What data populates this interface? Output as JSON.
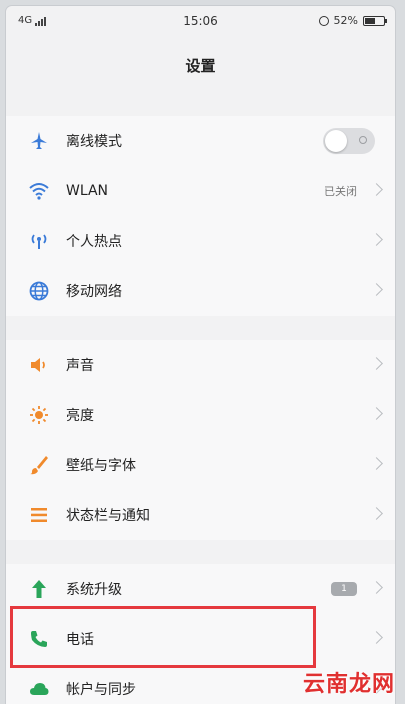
{
  "status_bar": {
    "network": "4G",
    "time": "15:06",
    "battery": "52%"
  },
  "title": "设置",
  "groups": [
    {
      "items": [
        {
          "name": "airplane",
          "label": "离线模式",
          "icon": "airplane-icon",
          "color": "#3b7bd8",
          "toggle": true,
          "toggle_on": false
        },
        {
          "name": "wlan",
          "label": "WLAN",
          "icon": "wifi-icon",
          "color": "#3b7bd8",
          "value": "已关闭"
        },
        {
          "name": "hotspot",
          "label": "个人热点",
          "icon": "hotspot-icon",
          "color": "#3b7bd8"
        },
        {
          "name": "mobile-network",
          "label": "移动网络",
          "icon": "globe-icon",
          "color": "#3b7bd8"
        }
      ]
    },
    {
      "items": [
        {
          "name": "sound",
          "label": "声音",
          "icon": "speaker-icon",
          "color": "#f08a2c"
        },
        {
          "name": "brightness",
          "label": "亮度",
          "icon": "sun-icon",
          "color": "#f08a2c"
        },
        {
          "name": "wallpaper-font",
          "label": "壁纸与字体",
          "icon": "brush-icon",
          "color": "#f08a2c"
        },
        {
          "name": "statusbar-notify",
          "label": "状态栏与通知",
          "icon": "list-icon",
          "color": "#f08a2c"
        }
      ]
    },
    {
      "items": [
        {
          "name": "system-update",
          "label": "系统升级",
          "icon": "arrow-up-icon",
          "color": "#2aa55a",
          "badge": "1"
        },
        {
          "name": "phone",
          "label": "电话",
          "icon": "phone-icon",
          "color": "#2aa55a"
        },
        {
          "name": "accounts-sync",
          "label": "帐户与同步",
          "icon": "cloud-icon",
          "color": "#2aa55a"
        }
      ]
    }
  ],
  "watermark": "云南龙网"
}
